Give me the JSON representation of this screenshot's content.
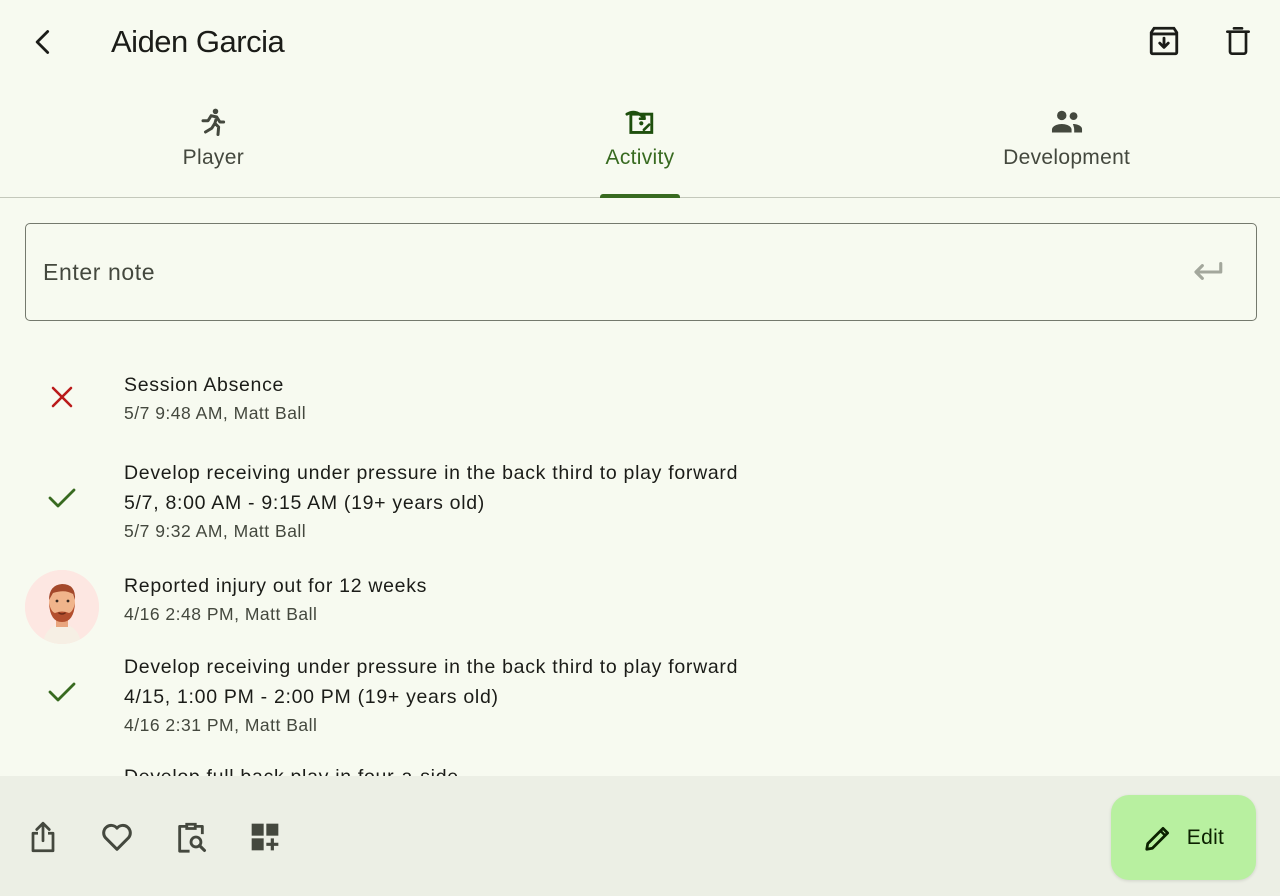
{
  "app_bar": {
    "title": "Aiden Garcia",
    "back_icon": "arrow-back-icon",
    "archive_icon": "archive-icon",
    "delete_icon": "delete-icon"
  },
  "tabs": [
    {
      "label": "Player",
      "icon": "running-person-icon",
      "active": false
    },
    {
      "label": "Activity",
      "icon": "activity-board-icon",
      "active": true
    },
    {
      "label": "Development",
      "icon": "people-icon",
      "active": false
    }
  ],
  "note": {
    "placeholder": "Enter note",
    "value": "",
    "submit_icon": "keyboard-return-icon"
  },
  "activities": [
    {
      "icon": "close-icon",
      "lines": [
        "Session Absence"
      ],
      "meta": "5/7 9:48 AM, Matt Ball"
    },
    {
      "icon": "check-icon",
      "lines": [
        "Develop receiving under pressure in the back third to play forward",
        "5/7, 8:00 AM - 9:15 AM (19+ years old)"
      ],
      "meta": "5/7 9:32 AM, Matt Ball"
    },
    {
      "icon": "avatar",
      "lines": [
        "Reported injury out for 12 weeks"
      ],
      "meta": "4/16 2:48 PM, Matt Ball"
    },
    {
      "icon": "check-icon",
      "lines": [
        "Develop receiving under pressure in the back third to play forward",
        "4/15, 1:00 PM - 2:00 PM (19+ years old)"
      ],
      "meta": "4/16 2:31 PM, Matt Ball"
    },
    {
      "icon": "check-icon",
      "lines": [
        "Develop full back play in four-a-side"
      ],
      "meta": ""
    }
  ],
  "bottom_bar": {
    "actions": [
      "share-icon",
      "favorite-icon",
      "clipboard-search-icon",
      "add-widget-icon"
    ],
    "edit_label": "Edit",
    "edit_icon": "pencil-icon"
  },
  "colors": {
    "background": "#f7faf0",
    "primary": "#386a20",
    "bottom_bar": "#ecefe5",
    "fab": "#b8f0a0",
    "error": "#ba1a1a"
  }
}
